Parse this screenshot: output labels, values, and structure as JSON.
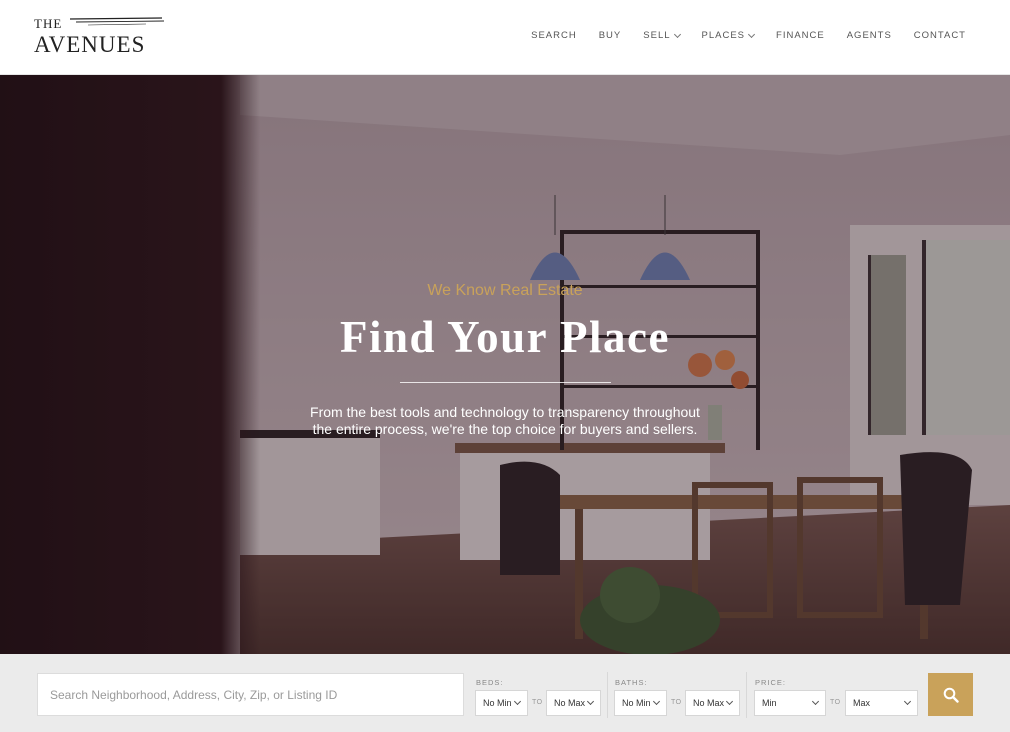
{
  "header": {
    "logo_small": "THE",
    "logo_main": "AVENUES",
    "nav": [
      {
        "label": "SEARCH",
        "has_dropdown": false
      },
      {
        "label": "BUY",
        "has_dropdown": false
      },
      {
        "label": "SELL",
        "has_dropdown": true
      },
      {
        "label": "PLACES",
        "has_dropdown": true
      },
      {
        "label": "FINANCE",
        "has_dropdown": false
      },
      {
        "label": "AGENTS",
        "has_dropdown": false
      },
      {
        "label": "CONTACT",
        "has_dropdown": false
      }
    ]
  },
  "hero": {
    "kicker": "We Know Real Estate",
    "title": "Find Your Place",
    "description": "From the best tools and technology to transparency throughout the entire process, we're the top choice for buyers and sellers."
  },
  "search": {
    "placeholder": "Search Neighborhood, Address, City, Zip, or Listing ID",
    "beds": {
      "label": "BEDS:",
      "min": "No Min",
      "max": "No Max"
    },
    "baths": {
      "label": "BATHS:",
      "min": "No Min",
      "max": "No Max"
    },
    "price": {
      "label": "PRICE:",
      "min": "Min",
      "max": "Max"
    },
    "to_label": "TO",
    "button_icon": "search-icon"
  },
  "colors": {
    "accent": "#c9a25a",
    "searchbar_bg": "#ebebeb"
  }
}
